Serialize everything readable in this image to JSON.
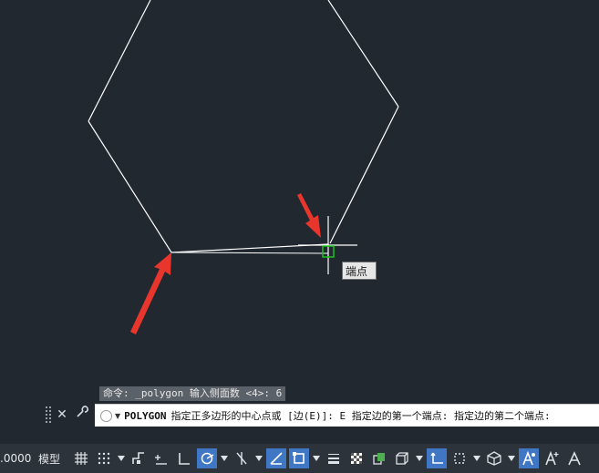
{
  "drawing": {
    "snap_tooltip": "端点"
  },
  "command": {
    "history": "命令: _polygon 输入侧面数 <4>: 6",
    "name": "POLYGON",
    "prompt": "指定正多边形的中心点或 [边(E)]: E 指定边的第一个端点: 指定边的第二个端点:"
  },
  "status_bar": {
    "scale": ".0000",
    "model": "模型",
    "buttons": [
      {
        "icon": "grid-icon",
        "active": false
      },
      {
        "icon": "snap-mode-icon",
        "active": false
      },
      {
        "icon": "dynamic-input-icon",
        "active": false
      },
      {
        "icon": "infer-constraints-icon",
        "active": false
      },
      {
        "icon": "ortho-mode-icon",
        "active": false
      },
      {
        "icon": "polar-tracking-icon",
        "active": true
      },
      {
        "icon": "isometric-drafting-icon",
        "active": false
      },
      {
        "icon": "object-snap-tracking-icon",
        "active": true
      },
      {
        "icon": "object-snap-icon",
        "active": true
      },
      {
        "icon": "lineweight-icon",
        "active": false
      },
      {
        "icon": "transparency-icon",
        "active": false
      },
      {
        "icon": "selection-cycling-icon",
        "active": false
      },
      {
        "icon": "3d-object-snap-icon",
        "active": false
      },
      {
        "icon": "dynamic-ucs-icon",
        "active": true
      },
      {
        "icon": "selection-filter-icon",
        "active": false
      },
      {
        "icon": "gizmo-icon",
        "active": false
      },
      {
        "icon": "annotation-visibility-icon",
        "active": true
      },
      {
        "icon": "auto-scale-icon",
        "active": false
      },
      {
        "icon": "annotation-scale-icon",
        "active": false
      }
    ]
  },
  "colors": {
    "background": "#212830",
    "geometry": "#ffffff",
    "arrow": "#e8362c",
    "snap_marker": "#18c318",
    "active_button": "#3f77c4"
  }
}
